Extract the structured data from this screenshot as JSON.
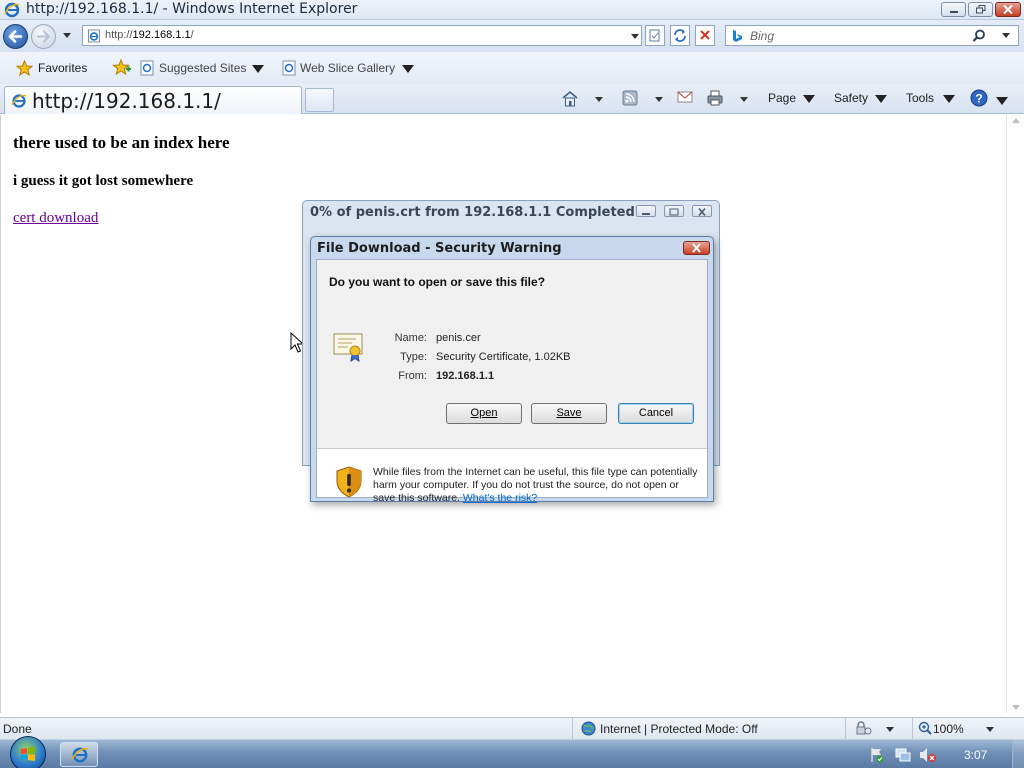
{
  "window": {
    "title": "http://192.168.1.1/ - Windows Internet Explorer",
    "caption_buttons": [
      "minimize-icon",
      "restore-icon",
      "close-icon"
    ]
  },
  "address_bar": {
    "url_prefix": "http://",
    "url_host": "192.168.1.1",
    "url_suffix": "/",
    "search_placeholder": "Bing"
  },
  "favorites_bar": {
    "favorites_label": "Favorites",
    "items": [
      "Suggested Sites",
      "Web Slice Gallery"
    ]
  },
  "tab": {
    "title": "http://192.168.1.1/"
  },
  "command_bar": {
    "page": "Page",
    "safety": "Safety",
    "tools": "Tools"
  },
  "page": {
    "heading": "there used to be an index here",
    "subheading": "i guess it got lost somewhere",
    "link": "cert download"
  },
  "progress_window": {
    "title": "0% of penis.crt from 192.168.1.1 Completed"
  },
  "download_dialog": {
    "title": "File Download - Security Warning",
    "question": "Do you want to open or save this file?",
    "name_label": "Name:",
    "name_value": "penis.cer",
    "type_label": "Type:",
    "type_value": "Security Certificate, 1.02KB",
    "from_label": "From:",
    "from_value": "192.168.1.1",
    "open_button": "Open",
    "save_button": "Save",
    "cancel_button": "Cancel",
    "warning_text": "While files from the Internet can be useful, this file type can potentially harm your computer. If you do not trust the source, do not open or save this software.",
    "risk_link": "What's the risk?"
  },
  "status_bar": {
    "status": "Done",
    "zone": "Internet | Protected Mode: Off",
    "zoom": "100%"
  },
  "taskbar": {
    "clock": "3:07"
  },
  "colors": {
    "visited_link": "#660099",
    "dialog_frame": "#c8d9ee",
    "close_red": "#c6402a",
    "info_link": "#0066cc"
  }
}
